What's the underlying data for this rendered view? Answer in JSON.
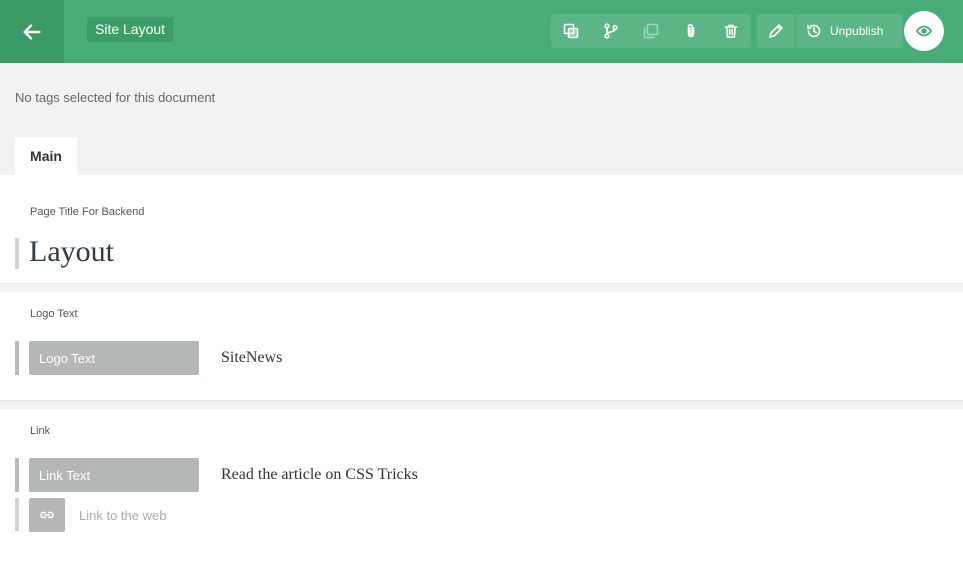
{
  "header": {
    "document_title": "Site Layout",
    "unpublish_label": "Unpublish",
    "toolbar_icons": [
      "duplicate-icon",
      "branch-icon",
      "copy-icon",
      "attach-icon",
      "trash-icon"
    ],
    "accent_color": "#49ab78"
  },
  "tags": {
    "message": "No tags selected for this document"
  },
  "tabs": [
    {
      "label": "Main",
      "active": true
    }
  ],
  "fields": {
    "page_title": {
      "label": "Page Title For Backend",
      "value": "Layout"
    },
    "logo_text": {
      "label": "Logo Text",
      "input_label": "Logo Text",
      "value": "SiteNews"
    },
    "link": {
      "label": "Link",
      "input_label": "Link Text",
      "value": "Read the article on CSS Tricks",
      "url_placeholder": "Link to the web"
    }
  }
}
